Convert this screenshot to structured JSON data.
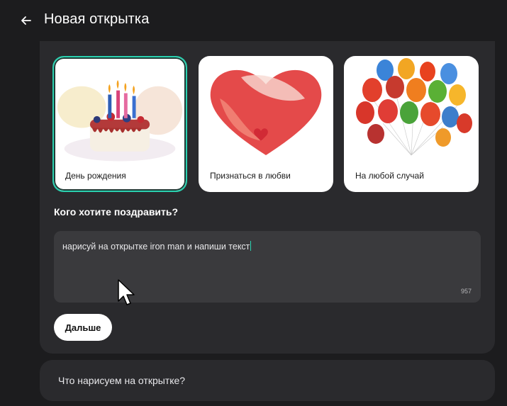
{
  "header": {
    "back_icon": "arrow-left-icon",
    "title": "Новая открытка"
  },
  "cards": [
    {
      "label": "День рождения",
      "art": "birthday-cake-watercolor",
      "selected": true
    },
    {
      "label": "Признаться в любви",
      "art": "heart-watercolor",
      "selected": false
    },
    {
      "label": "На любой случай",
      "art": "balloons-watercolor",
      "selected": false
    }
  ],
  "prompt": {
    "question": "Кого хотите поздравить?",
    "value": "нарисуй на открытке iron man и напиши текст",
    "counter": "957"
  },
  "next_button": {
    "label": "Дальше"
  },
  "collapsed_section": {
    "title": "Что нарисуем на открытке?"
  },
  "colors": {
    "background": "#1c1c1e",
    "panel": "#2a2a2d",
    "input": "#3a3a3d",
    "accent": "#2ad1b0"
  }
}
